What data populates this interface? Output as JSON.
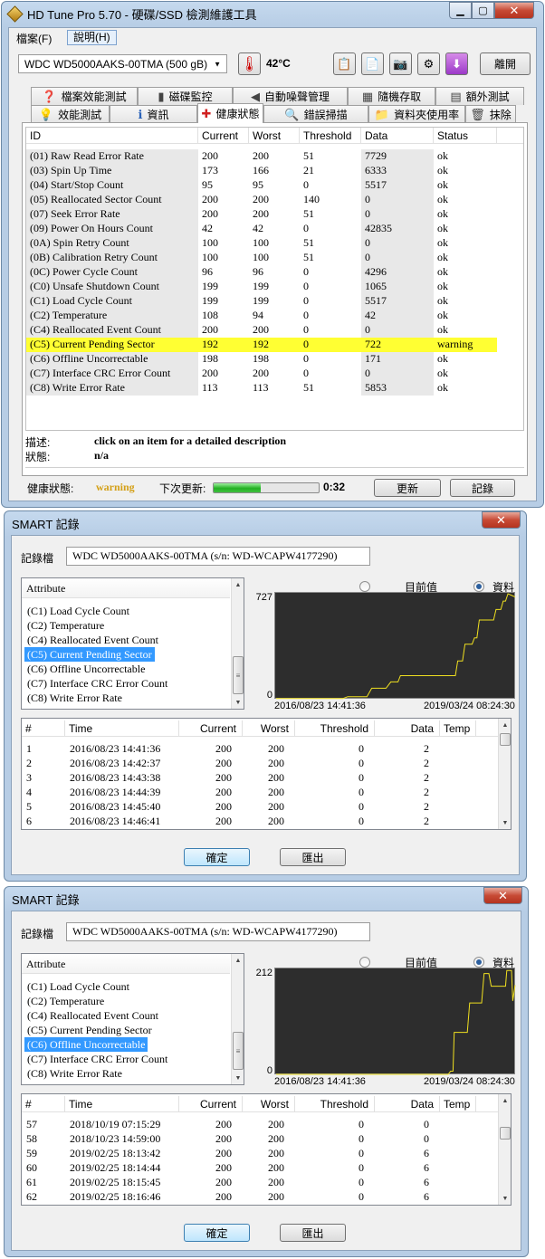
{
  "main_window": {
    "title": "HD Tune Pro 5.70 - 硬碟/SSD 檢測維護工具",
    "menu": [
      "檔案(F)",
      "說明(H)"
    ],
    "drive": "WDC WD5000AAKS-00TMA (500 gB)",
    "temperature": "42°C",
    "exit_label": "離開",
    "tabs_row1": [
      {
        "label": "檔案效能測試",
        "icon": "file-benchmark-icon",
        "glyph": "❓"
      },
      {
        "label": "磁碟監控",
        "icon": "disk-monitor-icon",
        "glyph": "▮"
      },
      {
        "label": "自動噪聲管理",
        "icon": "speaker-icon",
        "glyph": "◀"
      },
      {
        "label": "隨機存取",
        "icon": "random-access-icon",
        "glyph": "▦"
      },
      {
        "label": "額外測試",
        "icon": "extra-tests-icon",
        "glyph": "▤"
      }
    ],
    "tabs_row2": [
      {
        "label": "效能測試",
        "icon": "lightbulb-icon",
        "glyph": "💡"
      },
      {
        "label": "資訊",
        "icon": "info-icon",
        "glyph": "ℹ"
      },
      {
        "label": "健康狀態",
        "icon": "health-cross-icon",
        "glyph": "✚"
      },
      {
        "label": "錯誤掃描",
        "icon": "magnifier-icon",
        "glyph": "🔍"
      },
      {
        "label": "資料夾使用率",
        "icon": "folder-icon",
        "glyph": "📁"
      },
      {
        "label": "抹除",
        "icon": "trash-icon",
        "glyph": "🗑"
      }
    ],
    "health": {
      "columns": [
        "ID",
        "Current",
        "Worst",
        "Threshold",
        "Data",
        "Status"
      ],
      "rows": [
        [
          "(01) Raw Read Error Rate",
          "200",
          "200",
          "51",
          "7729",
          "ok"
        ],
        [
          "(03) Spin Up Time",
          "173",
          "166",
          "21",
          "6333",
          "ok"
        ],
        [
          "(04) Start/Stop Count",
          "95",
          "95",
          "0",
          "5517",
          "ok"
        ],
        [
          "(05) Reallocated Sector Count",
          "200",
          "200",
          "140",
          "0",
          "ok"
        ],
        [
          "(07) Seek Error Rate",
          "200",
          "200",
          "51",
          "0",
          "ok"
        ],
        [
          "(09) Power On Hours Count",
          "42",
          "42",
          "0",
          "42835",
          "ok"
        ],
        [
          "(0A) Spin Retry Count",
          "100",
          "100",
          "51",
          "0",
          "ok"
        ],
        [
          "(0B) Calibration Retry Count",
          "100",
          "100",
          "51",
          "0",
          "ok"
        ],
        [
          "(0C) Power Cycle Count",
          "96",
          "96",
          "0",
          "4296",
          "ok"
        ],
        [
          "(C0) Unsafe Shutdown Count",
          "199",
          "199",
          "0",
          "1065",
          "ok"
        ],
        [
          "(C1) Load Cycle Count",
          "199",
          "199",
          "0",
          "5517",
          "ok"
        ],
        [
          "(C2) Temperature",
          "108",
          "94",
          "0",
          "42",
          "ok"
        ],
        [
          "(C4) Reallocated Event Count",
          "200",
          "200",
          "0",
          "0",
          "ok"
        ],
        [
          "(C5) Current Pending Sector",
          "192",
          "192",
          "0",
          "722",
          "warning"
        ],
        [
          "(C6) Offline Uncorrectable",
          "198",
          "198",
          "0",
          "171",
          "ok"
        ],
        [
          "(C7) Interface CRC Error Count",
          "200",
          "200",
          "0",
          "0",
          "ok"
        ],
        [
          "(C8) Write Error Rate",
          "113",
          "113",
          "51",
          "5853",
          "ok"
        ]
      ],
      "highlight_color": "#ffff33"
    },
    "desc_label": "描述:",
    "desc_text": "click on an item for a detailed description",
    "state_label": "狀態:",
    "state_text": "n/a",
    "health_label": "健康狀態:",
    "health_value": "warning",
    "health_color": "#d4a017",
    "next_update_label": "下次更新:",
    "progress": 0.45,
    "countdown": "0:32",
    "refresh_label": "更新",
    "log_label": "記錄"
  },
  "smart1": {
    "title": "SMART 記錄",
    "log_label": "記錄檔",
    "log_file": "WDC WD5000AAKS-00TMA (s/n:     WD-WCAPW4177290)",
    "attr_header": "Attribute",
    "attributes": [
      "(C1) Load Cycle Count",
      "(C2) Temperature",
      "(C4) Reallocated Event Count",
      "(C5) Current Pending Sector",
      "(C6) Offline Uncorrectable",
      "(C7) Interface CRC Error Count",
      "(C8) Write Error Rate"
    ],
    "selected": 3,
    "radio_current": "目前值",
    "radio_data": "資料",
    "y_max": "727",
    "y_min": "0",
    "x_start": "2016/08/23 14:41:36",
    "x_end": "2019/03/24 08:24:30",
    "table_cols": [
      "#",
      "Time",
      "Current",
      "Worst",
      "Threshold",
      "Data",
      "Temp"
    ],
    "rows": [
      [
        "1",
        "2016/08/23 14:41:36",
        "200",
        "200",
        "0",
        "2",
        ""
      ],
      [
        "2",
        "2016/08/23 14:42:37",
        "200",
        "200",
        "0",
        "2",
        ""
      ],
      [
        "3",
        "2016/08/23 14:43:38",
        "200",
        "200",
        "0",
        "2",
        ""
      ],
      [
        "4",
        "2016/08/23 14:44:39",
        "200",
        "200",
        "0",
        "2",
        ""
      ],
      [
        "5",
        "2016/08/23 14:45:40",
        "200",
        "200",
        "0",
        "2",
        ""
      ],
      [
        "6",
        "2016/08/23 14:46:41",
        "200",
        "200",
        "0",
        "2",
        ""
      ]
    ],
    "ok_label": "確定",
    "export_label": "匯出",
    "line_color": "#f0e020"
  },
  "smart2": {
    "title": "SMART 記錄",
    "log_label": "記錄檔",
    "log_file": "WDC WD5000AAKS-00TMA (s/n:     WD-WCAPW4177290)",
    "attr_header": "Attribute",
    "attributes": [
      "(C1) Load Cycle Count",
      "(C2) Temperature",
      "(C4) Reallocated Event Count",
      "(C5) Current Pending Sector",
      "(C6) Offline Uncorrectable",
      "(C7) Interface CRC Error Count",
      "(C8) Write Error Rate"
    ],
    "selected": 4,
    "radio_current": "目前值",
    "radio_data": "資料",
    "y_max": "212",
    "y_min": "0",
    "x_start": "2016/08/23 14:41:36",
    "x_end": "2019/03/24 08:24:30",
    "table_cols": [
      "#",
      "Time",
      "Current",
      "Worst",
      "Threshold",
      "Data",
      "Temp"
    ],
    "rows": [
      [
        "57",
        "2018/10/19 07:15:29",
        "200",
        "200",
        "0",
        "0",
        ""
      ],
      [
        "58",
        "2018/10/23 14:59:00",
        "200",
        "200",
        "0",
        "0",
        ""
      ],
      [
        "59",
        "2019/02/25 18:13:42",
        "200",
        "200",
        "0",
        "6",
        ""
      ],
      [
        "60",
        "2019/02/25 18:14:44",
        "200",
        "200",
        "0",
        "6",
        ""
      ],
      [
        "61",
        "2019/02/25 18:15:45",
        "200",
        "200",
        "0",
        "6",
        ""
      ],
      [
        "62",
        "2019/02/25 18:16:46",
        "200",
        "200",
        "0",
        "6",
        ""
      ]
    ],
    "ok_label": "確定",
    "export_label": "匯出",
    "line_color": "#f0e020"
  }
}
